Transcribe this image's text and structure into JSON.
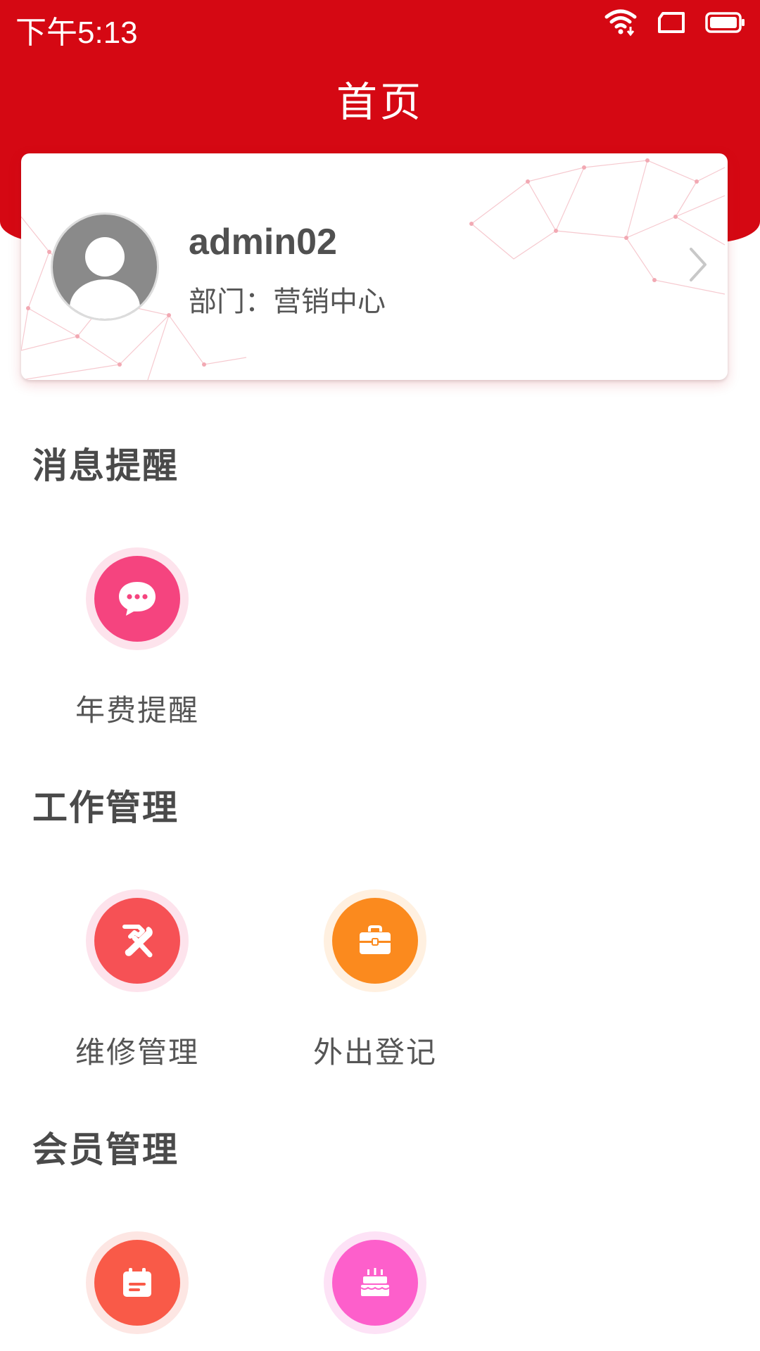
{
  "status_bar": {
    "time": "下午5:13",
    "icons": [
      "wifi-icon",
      "screen-rotate-icon",
      "battery-icon"
    ]
  },
  "header": {
    "title": "首页",
    "background_color": "#d50813"
  },
  "profile": {
    "username": "admin02",
    "department": "部门：营销中心"
  },
  "sections": [
    {
      "title": "消息提醒",
      "items": [
        {
          "label": "年费提醒",
          "icon": "chat-bubble-icon",
          "color": "#f5447f"
        }
      ]
    },
    {
      "title": "工作管理",
      "items": [
        {
          "label": "维修管理",
          "icon": "repair-tools-icon",
          "color": "#f65155"
        },
        {
          "label": "外出登记",
          "icon": "briefcase-icon",
          "color": "#fb8a1e"
        }
      ]
    },
    {
      "title": "会员管理",
      "items": [
        {
          "label": "",
          "icon": "calendar-icon",
          "color": "#f95a48"
        },
        {
          "label": "",
          "icon": "birthday-cake-icon",
          "color": "#fd5fcb"
        }
      ]
    }
  ]
}
